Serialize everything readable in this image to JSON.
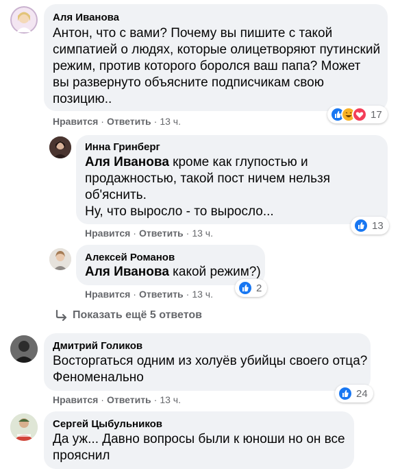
{
  "colors": {
    "bubble": "#f0f2f5",
    "meta_text": "#65676b",
    "like_blue": "#1877f2",
    "love_red": "#f33e58",
    "haha_yellow": "#f7b125"
  },
  "comments": [
    {
      "author": "Аля Иванова",
      "lines": [
        "Антон, что с вами? Почему вы пишите с такой",
        "симпатией о людях, которые олицетворяют путинский",
        "режим, против которого боролся ваш папа? Может",
        "вы развернуто объясните подписчикам свою",
        "позицию.."
      ],
      "like": "Нравится",
      "reply": "Ответить",
      "time": "13 ч.",
      "reactions": [
        "like-icon",
        "haha-icon",
        "love-icon"
      ],
      "reaction_count": "17"
    },
    {
      "author": "Инна Гринберг",
      "mention": "Аля Иванова",
      "lines": [
        " кроме как глупостью и",
        "продажностью, такой пост ничем нельзя",
        "об'яснить.",
        "Ну, что выросло - то выросло..."
      ],
      "like": "Нравится",
      "reply": "Ответить",
      "time": "13 ч.",
      "reactions": [
        "like-icon"
      ],
      "reaction_count": "13"
    },
    {
      "author": "Алексей Романов",
      "mention": "Аля Иванова",
      "lines": [
        " какой режим?)"
      ],
      "like": "Нравится",
      "reply": "Ответить",
      "time": "13 ч.",
      "reactions": [
        "like-icon"
      ],
      "reaction_count": "2"
    },
    {
      "author": "Дмитрий Голиков",
      "lines": [
        "Восторгаться одним из холуёв убийцы своего отца?",
        "Феноменально"
      ],
      "like": "Нравится",
      "reply": "Ответить",
      "time": "13 ч.",
      "reactions": [
        "like-icon"
      ],
      "reaction_count": "24"
    },
    {
      "author": "Сергей Цыбульников",
      "lines": [
        "Да уж... Давно вопросы были к юноши но он все",
        "прояснил"
      ]
    }
  ],
  "more_replies": {
    "icon": "reply-arrow-icon",
    "label": "Показать ещё 5 ответов"
  }
}
